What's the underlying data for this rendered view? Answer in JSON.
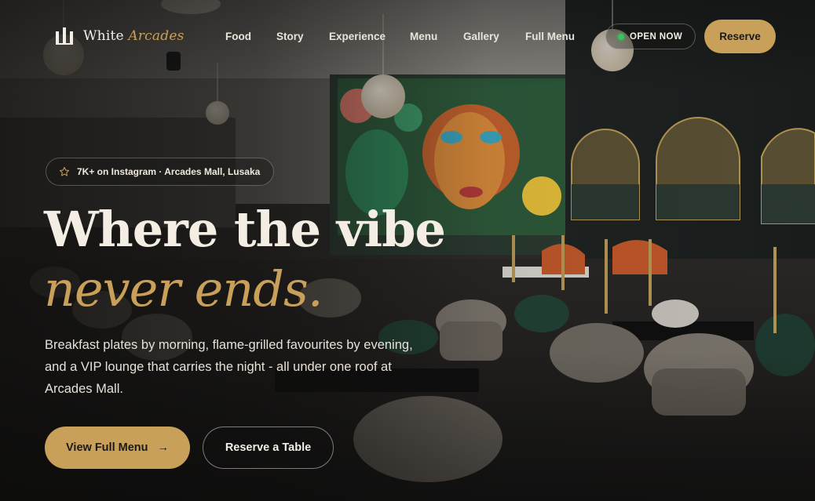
{
  "brand": {
    "name_plain": "White",
    "name_italic": "Arcades"
  },
  "nav": {
    "links": [
      "Food",
      "Story",
      "Experience",
      "Menu",
      "Gallery",
      "Full Menu"
    ],
    "status_label": "OPEN NOW",
    "reserve_label": "Reserve"
  },
  "hero": {
    "badge_text": "7K+ on Instagram · Arcades Mall, Lusaka",
    "headline_line1": "Where the vibe",
    "headline_line2": "never ends.",
    "copy": "Breakfast plates by morning, flame-grilled favourites by evening, and a VIP lounge that carries the night - all under one roof at Arcades Mall.",
    "primary_button": "View Full Menu",
    "primary_arrow": "→",
    "secondary_button": "Reserve a Table"
  },
  "icons": {
    "logo": "arcades-logo-icon",
    "star": "star-icon",
    "arrow": "arrow-right-icon",
    "status": "status-dot-icon"
  },
  "colors": {
    "accent": "#c9a05a",
    "status_green": "#37c35a",
    "background": "#1b1a18",
    "text": "#f3ede3"
  }
}
